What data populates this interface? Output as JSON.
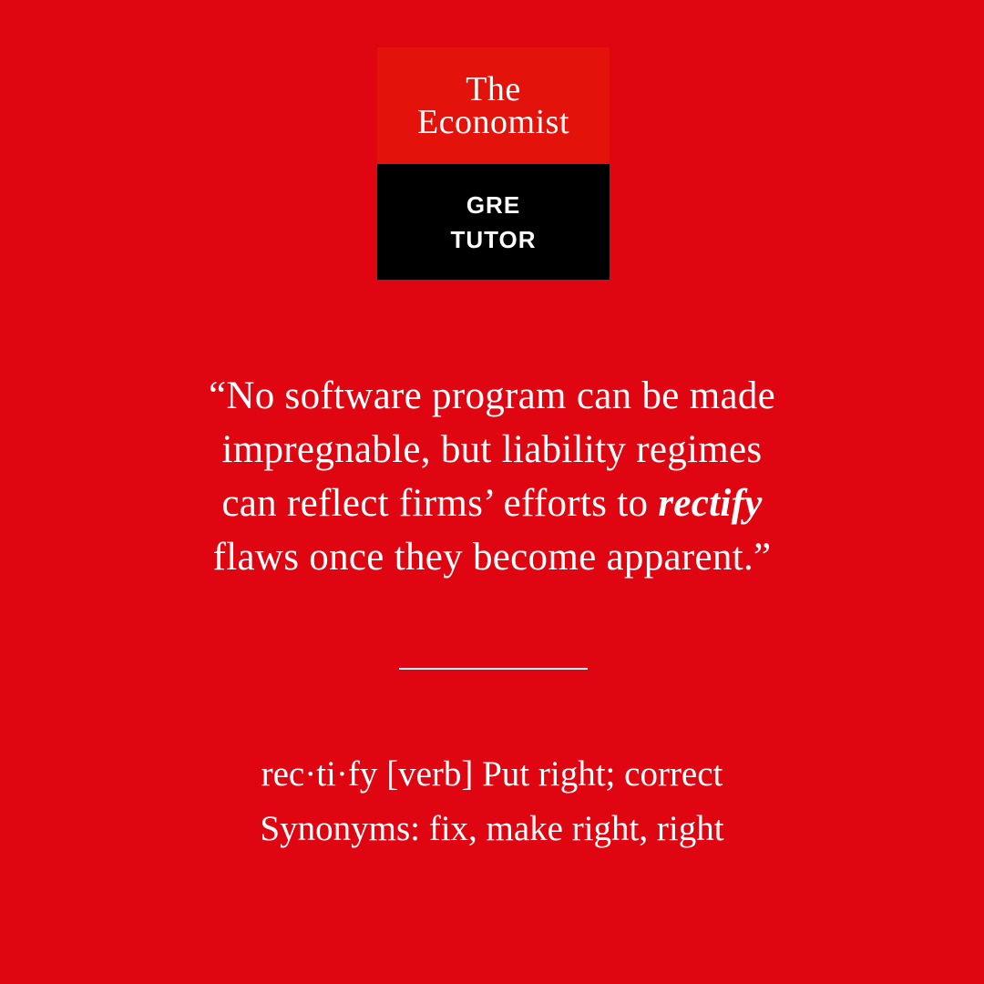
{
  "logo": {
    "line1": "The",
    "line2": "Economist",
    "sub_line1": "GRE",
    "sub_line2": "TUTOR"
  },
  "quote": {
    "line1": "“No software program can be made",
    "line2": "impregnable, but liability regimes",
    "line3_before": "can reflect firms’ efforts to ",
    "keyword": "rectify",
    "line4": "flaws once they become apparent.”"
  },
  "definition": {
    "line1": "rec·ti·fy [verb] Put right; correct",
    "line2": "Synonyms: fix, make right, right"
  },
  "colors": {
    "background": "#e00611",
    "logo_red": "#e3120b",
    "logo_black": "#000000",
    "text": "#ffffff"
  }
}
